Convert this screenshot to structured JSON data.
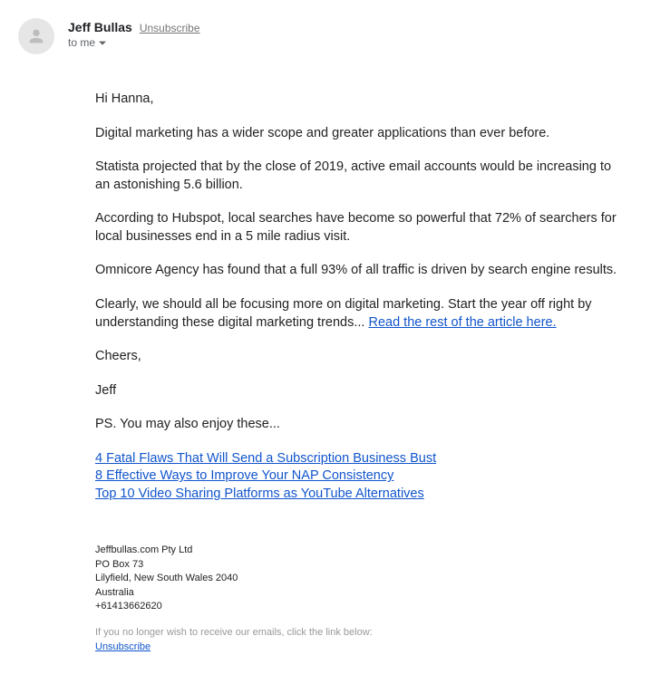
{
  "header": {
    "sender_name": "Jeff Bullas",
    "unsubscribe_label": "Unsubscribe",
    "to_label": "to me"
  },
  "body": {
    "greeting": "Hi Hanna,",
    "p1": "Digital marketing has a wider scope and greater applications than ever before.",
    "p2": "Statista projected that by the close of 2019, active email accounts would be increasing to an astonishing 5.6 billion.",
    "p3": "According to Hubspot, local searches have become so powerful that 72% of searchers for local businesses end in a 5 mile radius visit.",
    "p4": "Omnicore Agency has found that a full 93% of all traffic is driven by search engine results.",
    "p5_prefix": "Clearly, we should all be focusing more on digital marketing. Start the year off right by understanding these digital marketing trends... ",
    "p5_link": "Read the rest of the article here.",
    "cheers": "Cheers,",
    "signoff": "Jeff",
    "ps": "PS. You may also enjoy these...",
    "links": {
      "l1": "4 Fatal Flaws That Will Send a Subscription Business Bust",
      "l2": "8 Effective Ways to Improve Your NAP Consistency",
      "l3": "Top 10 Video Sharing Platforms as YouTube Alternatives"
    }
  },
  "footer": {
    "company": "Jeffbullas.com Pty Ltd",
    "po_box": "PO Box 73",
    "city": "Lilyfield, New South Wales 2040",
    "country": "Australia",
    "phone": "+61413662620",
    "note": "If you no longer wish to receive our emails, click the link below:",
    "unsubscribe": "Unsubscribe"
  }
}
